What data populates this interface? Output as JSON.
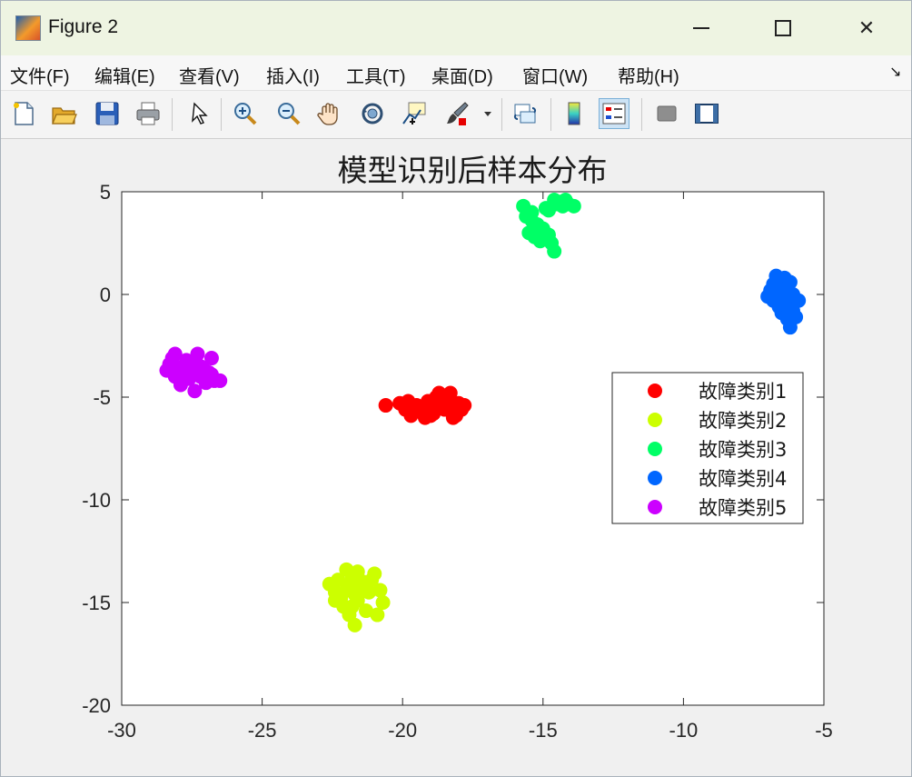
{
  "window": {
    "title": "Figure 2",
    "minimize_label": "minimize",
    "maximize_label": "maximize",
    "close_glyph": "✕"
  },
  "menu": {
    "items": [
      "文件(F)",
      "编辑(E)",
      "查看(V)",
      "插入(I)",
      "工具(T)",
      "桌面(D)",
      "窗口(W)",
      "帮助(H)"
    ],
    "dock_glyph": "↘"
  },
  "toolbar": {
    "icons": [
      "new-figure-icon",
      "open-file-icon",
      "save-icon",
      "print-icon",
      "pointer-icon",
      "zoom-in-icon",
      "zoom-out-icon",
      "pan-icon",
      "rotate-3d-icon",
      "data-cursor-icon",
      "brush-icon",
      "link-plot-icon",
      "colorbar-icon",
      "legend-icon",
      "hide-plot-tools-icon",
      "show-plot-tools-icon"
    ]
  },
  "colors": {
    "series1": "#ff0000",
    "series2": "#ccff00",
    "series3": "#00ff66",
    "series4": "#0066ff",
    "series5": "#cc00ff"
  },
  "chart_data": {
    "type": "scatter",
    "title": "模型识别后样本分布",
    "xlabel": "",
    "ylabel": "",
    "xlim": [
      -30,
      -5
    ],
    "ylim": [
      -20,
      5
    ],
    "xticks": [
      -30,
      -25,
      -20,
      -15,
      -10,
      -5
    ],
    "yticks": [
      -20,
      -15,
      -10,
      -5,
      0,
      5
    ],
    "xtick_labels": [
      "-30",
      "-25",
      "-20",
      "-15",
      "-10",
      "-5"
    ],
    "ytick_labels": [
      "-20",
      "-15",
      "-10",
      "-5",
      "0",
      "5"
    ],
    "grid": false,
    "legend_position": "right",
    "series": [
      {
        "name": "故障类别1",
        "color": "#ff0000",
        "points": [
          [
            -20.6,
            -5.4
          ],
          [
            -20.1,
            -5.3
          ],
          [
            -19.9,
            -5.6
          ],
          [
            -19.7,
            -5.9
          ],
          [
            -19.5,
            -5.4
          ],
          [
            -19.3,
            -5.7
          ],
          [
            -19.1,
            -5.2
          ],
          [
            -19.0,
            -5.9
          ],
          [
            -18.9,
            -5.5
          ],
          [
            -18.8,
            -5.0
          ],
          [
            -18.6,
            -5.3
          ],
          [
            -18.5,
            -5.6
          ],
          [
            -18.4,
            -5.1
          ],
          [
            -18.3,
            -4.8
          ],
          [
            -18.2,
            -5.5
          ],
          [
            -18.1,
            -5.9
          ],
          [
            -18.0,
            -5.3
          ],
          [
            -17.9,
            -5.6
          ],
          [
            -17.8,
            -5.4
          ],
          [
            -18.7,
            -4.8
          ],
          [
            -19.2,
            -6.0
          ],
          [
            -18.2,
            -6.0
          ],
          [
            -19.8,
            -5.2
          ],
          [
            -18.9,
            -5.8
          ],
          [
            -18.6,
            -5.5
          ]
        ]
      },
      {
        "name": "故障类别2",
        "color": "#ccff00",
        "points": [
          [
            -22.6,
            -14.1
          ],
          [
            -22.4,
            -14.5
          ],
          [
            -22.3,
            -13.9
          ],
          [
            -22.2,
            -14.8
          ],
          [
            -22.1,
            -15.2
          ],
          [
            -22.0,
            -13.4
          ],
          [
            -21.9,
            -14.2
          ],
          [
            -21.9,
            -15.6
          ],
          [
            -21.8,
            -13.8
          ],
          [
            -21.7,
            -14.6
          ],
          [
            -21.7,
            -16.1
          ],
          [
            -21.6,
            -13.5
          ],
          [
            -21.5,
            -14.3
          ],
          [
            -21.4,
            -14.0
          ],
          [
            -21.3,
            -15.4
          ],
          [
            -21.2,
            -14.5
          ],
          [
            -21.1,
            -13.9
          ],
          [
            -21.0,
            -13.6
          ],
          [
            -20.9,
            -15.6
          ],
          [
            -20.8,
            -14.4
          ],
          [
            -20.7,
            -15.0
          ],
          [
            -22.4,
            -14.9
          ],
          [
            -21.8,
            -15.2
          ],
          [
            -22.0,
            -14.4
          ],
          [
            -21.6,
            -14.9
          ]
        ]
      },
      {
        "name": "故障类别3",
        "color": "#00ff66",
        "points": [
          [
            -15.7,
            4.3
          ],
          [
            -15.6,
            3.8
          ],
          [
            -15.5,
            3.0
          ],
          [
            -15.4,
            4.0
          ],
          [
            -15.3,
            2.8
          ],
          [
            -15.2,
            3.4
          ],
          [
            -15.1,
            2.6
          ],
          [
            -15.0,
            3.2
          ],
          [
            -14.9,
            4.2
          ],
          [
            -14.8,
            2.9
          ],
          [
            -14.7,
            2.5
          ],
          [
            -14.6,
            2.1
          ],
          [
            -14.6,
            4.6
          ],
          [
            -14.5,
            4.4
          ],
          [
            -14.4,
            4.5
          ],
          [
            -14.3,
            4.3
          ],
          [
            -14.2,
            4.6
          ],
          [
            -14.1,
            4.4
          ],
          [
            -13.9,
            4.3
          ],
          [
            -14.8,
            4.1
          ],
          [
            -15.4,
            3.6
          ],
          [
            -15.0,
            2.7
          ]
        ]
      },
      {
        "name": "故障类别4",
        "color": "#0066ff",
        "points": [
          [
            -7.0,
            -0.1
          ],
          [
            -6.9,
            0.2
          ],
          [
            -6.8,
            -0.3
          ],
          [
            -6.8,
            0.5
          ],
          [
            -6.7,
            0.9
          ],
          [
            -6.7,
            -0.2
          ],
          [
            -6.6,
            0.1
          ],
          [
            -6.6,
            -0.6
          ],
          [
            -6.5,
            0.4
          ],
          [
            -6.5,
            -0.9
          ],
          [
            -6.4,
            0.8
          ],
          [
            -6.4,
            -0.1
          ],
          [
            -6.3,
            0.3
          ],
          [
            -6.3,
            -1.2
          ],
          [
            -6.2,
            -0.5
          ],
          [
            -6.2,
            0.6
          ],
          [
            -6.2,
            -1.6
          ],
          [
            -6.1,
            -0.8
          ],
          [
            -6.1,
            0.0
          ],
          [
            -6.0,
            -1.1
          ],
          [
            -5.9,
            -0.3
          ],
          [
            -6.5,
            -0.3
          ],
          [
            -6.7,
            0.4
          ],
          [
            -6.4,
            -0.5
          ]
        ]
      },
      {
        "name": "故障类别5",
        "color": "#cc00ff",
        "points": [
          [
            -28.4,
            -3.7
          ],
          [
            -28.3,
            -3.4
          ],
          [
            -28.2,
            -3.1
          ],
          [
            -28.1,
            -4.0
          ],
          [
            -28.1,
            -2.9
          ],
          [
            -28.0,
            -3.8
          ],
          [
            -27.9,
            -4.4
          ],
          [
            -27.8,
            -3.5
          ],
          [
            -27.7,
            -3.2
          ],
          [
            -27.6,
            -4.1
          ],
          [
            -27.5,
            -3.7
          ],
          [
            -27.4,
            -3.3
          ],
          [
            -27.4,
            -4.7
          ],
          [
            -27.3,
            -2.9
          ],
          [
            -27.2,
            -4.0
          ],
          [
            -27.1,
            -3.6
          ],
          [
            -27.0,
            -4.3
          ],
          [
            -26.9,
            -3.8
          ],
          [
            -26.8,
            -3.1
          ],
          [
            -26.7,
            -4.2
          ],
          [
            -26.5,
            -4.2
          ],
          [
            -27.6,
            -3.9
          ],
          [
            -27.2,
            -3.5
          ],
          [
            -27.9,
            -3.6
          ],
          [
            -26.8,
            -3.9
          ]
        ]
      }
    ]
  }
}
